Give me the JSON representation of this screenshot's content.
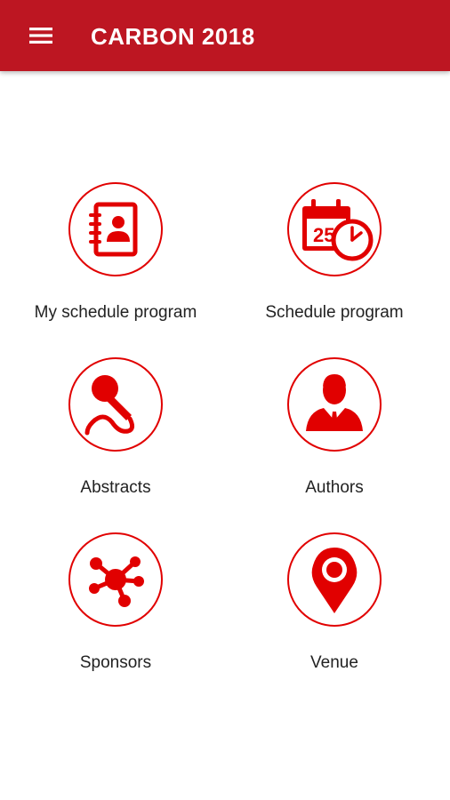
{
  "app_bar": {
    "title": "CARBON 2018",
    "menu_icon": "hamburger-menu-icon",
    "background_color": "#bd1622"
  },
  "accent_color": "#e10000",
  "tiles": [
    {
      "label": "My schedule program",
      "icon": "contact-book-icon"
    },
    {
      "label": "Schedule program",
      "icon": "calendar-clock-icon"
    },
    {
      "label": "Abstracts",
      "icon": "microphone-icon"
    },
    {
      "label": "Authors",
      "icon": "businessman-icon"
    },
    {
      "label": "Sponsors",
      "icon": "network-nodes-icon"
    },
    {
      "label": "Venue",
      "icon": "map-pin-icon"
    }
  ]
}
